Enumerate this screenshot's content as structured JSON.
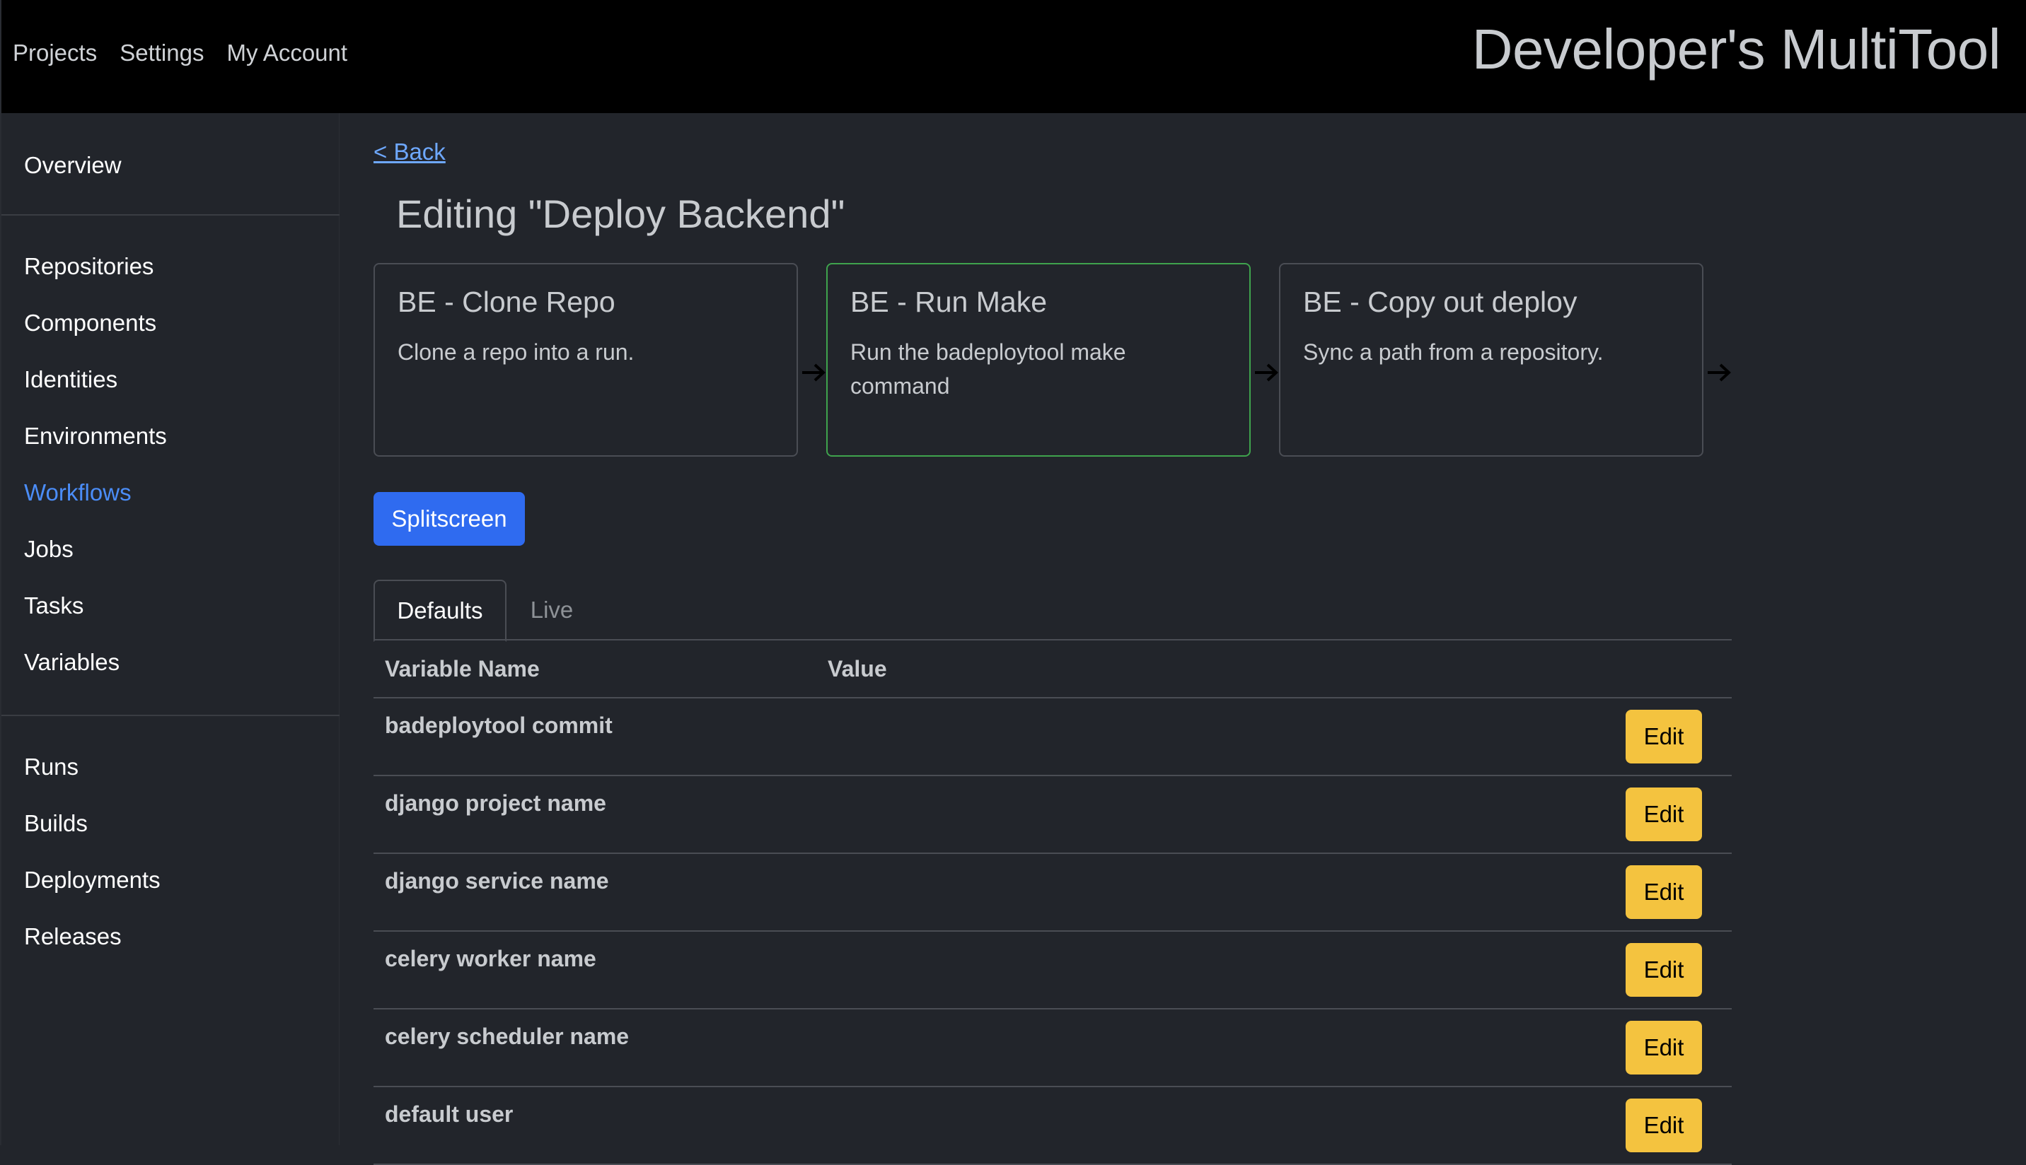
{
  "topnav": {
    "items": [
      "Projects",
      "Settings",
      "My Account"
    ]
  },
  "brand": "Developer's MultiTool",
  "sidebar": {
    "overview": "Overview",
    "group1": [
      "Repositories",
      "Components",
      "Identities",
      "Environments",
      "Workflows",
      "Jobs",
      "Tasks",
      "Variables"
    ],
    "group2": [
      "Runs",
      "Builds",
      "Deployments",
      "Releases"
    ],
    "active": "Workflows"
  },
  "main": {
    "back_label": "< Back",
    "title": "Editing \"Deploy Backend\"",
    "steps": [
      {
        "title": "BE - Clone Repo",
        "description": "Clone a repo into a run."
      },
      {
        "title": "BE - Run Make",
        "description": "Run the badeploytool make command"
      },
      {
        "title": "BE - Copy out deploy",
        "description": "Sync a path from a repository."
      }
    ],
    "selected_step": "BE - Run Make",
    "splitscreen_label": "Splitscreen",
    "tabs": [
      {
        "label": "Defaults",
        "active": true
      },
      {
        "label": "Live",
        "active": false
      }
    ],
    "table": {
      "columns": [
        "Variable Name",
        "Value"
      ],
      "edit_label": "Edit",
      "rows": [
        {
          "name": "badeploytool commit",
          "value": ""
        },
        {
          "name": "django project name",
          "value": ""
        },
        {
          "name": "django service name",
          "value": ""
        },
        {
          "name": "celery worker name",
          "value": ""
        },
        {
          "name": "celery scheduler name",
          "value": ""
        },
        {
          "name": "default user",
          "value": ""
        }
      ]
    }
  },
  "colors": {
    "accent_blue": "#2f6bf0",
    "active_link": "#4b8df8",
    "selected_border": "#3fa34d",
    "edit_button": "#f4c33f",
    "background": "#22252b",
    "topbar": "#000000"
  },
  "icons": {
    "step_connector": "arrow-right-icon"
  }
}
